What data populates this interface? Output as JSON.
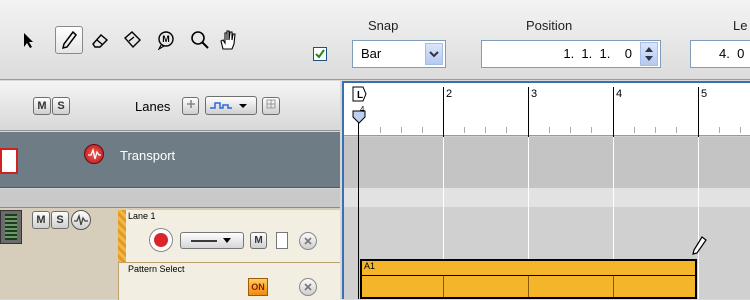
{
  "toolbar": {
    "tools": [
      {
        "name": "select-arrow-icon",
        "selected": false
      },
      {
        "name": "pencil-icon",
        "selected": true
      },
      {
        "name": "eraser-icon",
        "selected": false
      },
      {
        "name": "razor-icon",
        "selected": false
      },
      {
        "name": "mute-tool-icon",
        "selected": false
      },
      {
        "name": "magnify-icon",
        "selected": false
      },
      {
        "name": "hand-icon",
        "selected": false
      }
    ],
    "snap_label": "Snap",
    "snap_enabled": true,
    "snap_value": "Bar",
    "position_label": "Position",
    "position_value": "1.  1.  1.    0",
    "length_label": "Le",
    "length_value": "4.  0"
  },
  "lanes_header": {
    "mute_label": "M",
    "solo_label": "S",
    "lanes_label": "Lanes"
  },
  "tracks": {
    "transport": {
      "name": "Transport"
    },
    "lane1": {
      "mute_label": "M",
      "solo_label": "S",
      "lane_name": "Lane 1",
      "lane_mute": "M",
      "pattern_select_label": "Pattern Select",
      "on_label": "ON"
    }
  },
  "timeline": {
    "bars": [
      "2",
      "3",
      "4",
      "5"
    ],
    "loop_marker": "L",
    "loop_sub": "4",
    "clip_label": "A1"
  },
  "colors": {
    "accent_blue": "#3a6fb2",
    "clip_orange": "#f5b52a",
    "transport_bg": "#6e7d85",
    "record_red": "#d9262b"
  }
}
